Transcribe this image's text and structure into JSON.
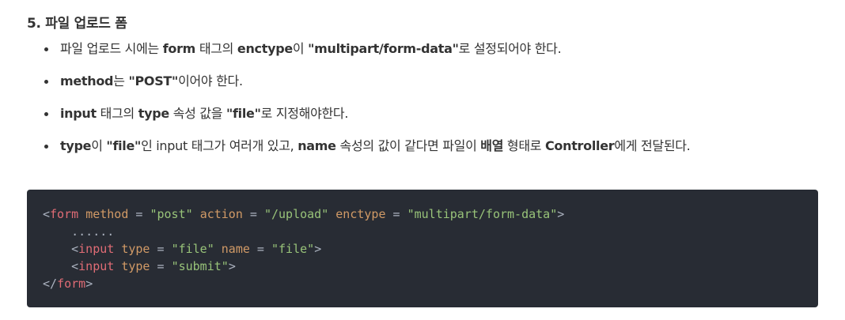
{
  "section": {
    "title": "5. 파일 업로드 폼"
  },
  "bullets": [
    {
      "parts": [
        {
          "text": "파일 업로드 시에는 ",
          "bold": false
        },
        {
          "text": "form",
          "bold": true
        },
        {
          "text": " 태그의 ",
          "bold": false
        },
        {
          "text": "enctype",
          "bold": true
        },
        {
          "text": "이 ",
          "bold": false
        },
        {
          "text": "\"multipart/form-data\"",
          "bold": true
        },
        {
          "text": "로 설정되어야 한다.",
          "bold": false
        }
      ]
    },
    {
      "parts": [
        {
          "text": "method",
          "bold": true
        },
        {
          "text": "는 ",
          "bold": false
        },
        {
          "text": "\"POST\"",
          "bold": true
        },
        {
          "text": "이어야 한다.",
          "bold": false
        }
      ]
    },
    {
      "parts": [
        {
          "text": "input",
          "bold": true
        },
        {
          "text": " 태그의 ",
          "bold": false
        },
        {
          "text": "type",
          "bold": true
        },
        {
          "text": " 속성 값을 ",
          "bold": false
        },
        {
          "text": "\"file\"",
          "bold": true
        },
        {
          "text": "로 지정해야한다.",
          "bold": false
        }
      ]
    },
    {
      "parts": [
        {
          "text": "type",
          "bold": true
        },
        {
          "text": "이 ",
          "bold": false
        },
        {
          "text": "\"file\"",
          "bold": true
        },
        {
          "text": "인 input 태그가 여러개 있고, ",
          "bold": false
        },
        {
          "text": "name",
          "bold": true
        },
        {
          "text": " 속성의 값이 같다면 파일이 ",
          "bold": false
        },
        {
          "text": "배열",
          "bold": true
        },
        {
          "text": " 형태로 ",
          "bold": false
        },
        {
          "text": "Controller",
          "bold": true
        },
        {
          "text": "에게 전달된다.",
          "bold": false
        }
      ]
    }
  ],
  "code": {
    "lines": [
      [
        {
          "t": "<",
          "c": "pun"
        },
        {
          "t": "form",
          "c": "tag"
        },
        {
          "t": " ",
          "c": "pun"
        },
        {
          "t": "method",
          "c": "attr"
        },
        {
          "t": " = ",
          "c": "pun"
        },
        {
          "t": "\"post\"",
          "c": "str"
        },
        {
          "t": " ",
          "c": "pun"
        },
        {
          "t": "action",
          "c": "attr"
        },
        {
          "t": " = ",
          "c": "pun"
        },
        {
          "t": "\"/upload\"",
          "c": "str"
        },
        {
          "t": " ",
          "c": "pun"
        },
        {
          "t": "enctype",
          "c": "attr"
        },
        {
          "t": " = ",
          "c": "pun"
        },
        {
          "t": "\"multipart/form-data\"",
          "c": "str"
        },
        {
          "t": ">",
          "c": "pun"
        }
      ],
      [
        {
          "t": "    ......",
          "c": "pun"
        }
      ],
      [
        {
          "t": "    <",
          "c": "pun"
        },
        {
          "t": "input",
          "c": "tag"
        },
        {
          "t": " ",
          "c": "pun"
        },
        {
          "t": "type",
          "c": "attr"
        },
        {
          "t": " = ",
          "c": "pun"
        },
        {
          "t": "\"file\"",
          "c": "str"
        },
        {
          "t": " ",
          "c": "pun"
        },
        {
          "t": "name",
          "c": "attr"
        },
        {
          "t": " = ",
          "c": "pun"
        },
        {
          "t": "\"file\"",
          "c": "str"
        },
        {
          "t": ">",
          "c": "pun"
        }
      ],
      [
        {
          "t": "    <",
          "c": "pun"
        },
        {
          "t": "input",
          "c": "tag"
        },
        {
          "t": " ",
          "c": "pun"
        },
        {
          "t": "type",
          "c": "attr"
        },
        {
          "t": " = ",
          "c": "pun"
        },
        {
          "t": "\"submit\"",
          "c": "str"
        },
        {
          "t": ">",
          "c": "pun"
        }
      ],
      [
        {
          "t": "</",
          "c": "pun"
        },
        {
          "t": "form",
          "c": "tag"
        },
        {
          "t": ">",
          "c": "pun"
        }
      ]
    ]
  },
  "colors": {
    "code_bg": "#282c34",
    "tag": "#e06c75",
    "attr": "#d19a66",
    "string": "#98c379",
    "punct": "#abb2bf"
  }
}
